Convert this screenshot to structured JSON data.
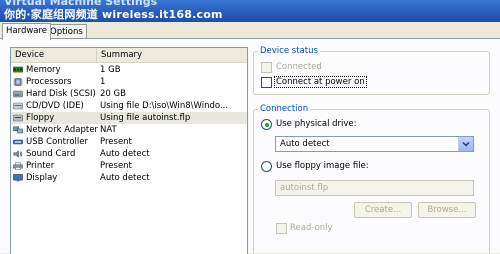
{
  "window": {
    "title": "Virtual Machine Settings",
    "watermark_text": "你的·家庭组网频道 wireless.it168.com"
  },
  "tabs": [
    {
      "label": "Hardware",
      "active": true
    },
    {
      "label": "Options",
      "active": false
    }
  ],
  "device_list": {
    "columns": {
      "device": "Device",
      "summary": "Summary"
    },
    "rows": [
      {
        "device": "Memory",
        "summary": "1 GB",
        "icon": "memory-icon"
      },
      {
        "device": "Processors",
        "summary": "1",
        "icon": "processor-icon"
      },
      {
        "device": "Hard Disk (SCSI)",
        "summary": "20 GB",
        "icon": "hard-disk-icon"
      },
      {
        "device": "CD/DVD (IDE)",
        "summary": "Using file D:\\iso\\Win8\\Windo...",
        "icon": "cd-dvd-icon"
      },
      {
        "device": "Floppy",
        "summary": "Using file autoinst.flp",
        "icon": "floppy-icon",
        "selected": true
      },
      {
        "device": "Network Adapter",
        "summary": "NAT",
        "icon": "network-adapter-icon"
      },
      {
        "device": "USB Controller",
        "summary": "Present",
        "icon": "usb-controller-icon"
      },
      {
        "device": "Sound Card",
        "summary": "Auto detect",
        "icon": "sound-card-icon"
      },
      {
        "device": "Printer",
        "summary": "Present",
        "icon": "printer-icon"
      },
      {
        "device": "Display",
        "summary": "Auto detect",
        "icon": "display-icon"
      }
    ]
  },
  "device_status": {
    "legend": "Device status",
    "connected": {
      "label": "Connected",
      "checked": false,
      "enabled": false
    },
    "connect_at_power_on": {
      "label": "Connect at power on",
      "checked": false,
      "enabled": true
    }
  },
  "connection": {
    "legend": "Connection",
    "use_physical_drive": {
      "label": "Use physical drive:",
      "selected": true
    },
    "physical_drive_value": "Auto detect",
    "use_floppy_image": {
      "label": "Use floppy image file:",
      "selected": false
    },
    "image_file_value": "autoinst.flp",
    "create_button": "Create...",
    "browse_button": "Browse...",
    "read_only": {
      "label": "Read-only",
      "checked": false,
      "enabled": false
    }
  },
  "colors": {
    "accent_title": "#2a5fbf",
    "group_legend": "#0046d5",
    "selection_bg": "#e8e7df",
    "radio_dot": "#21a121"
  }
}
